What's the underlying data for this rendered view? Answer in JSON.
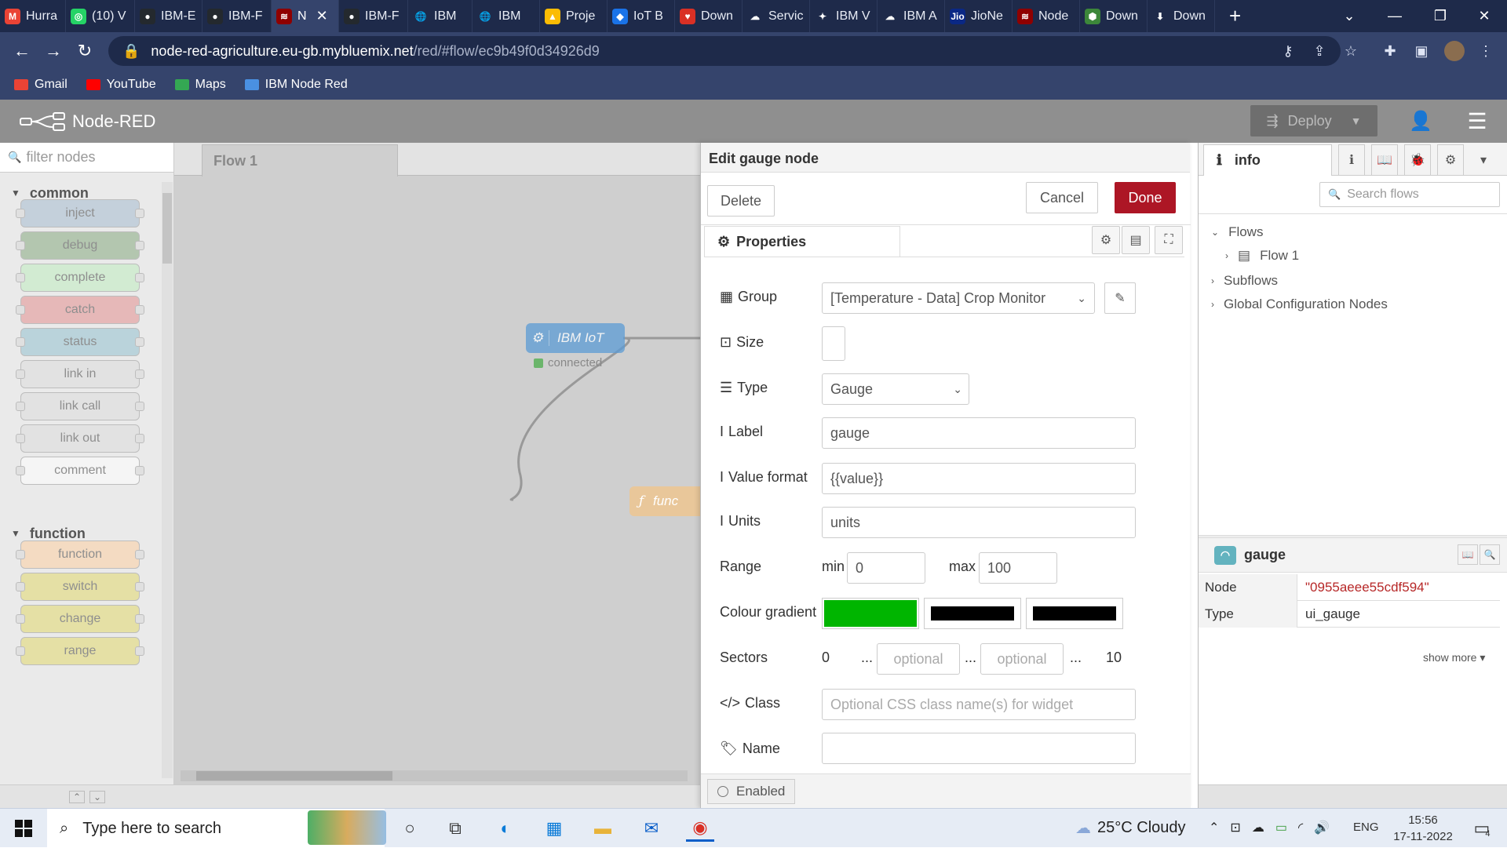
{
  "browser": {
    "tabs": [
      {
        "label": "Hurra",
        "icon": "gmail-icon",
        "color": "#ea4335",
        "glyph": "M"
      },
      {
        "label": "(10) V",
        "icon": "whatsapp-icon",
        "color": "#25d366",
        "glyph": "◎"
      },
      {
        "label": "IBM-E",
        "icon": "github-icon",
        "color": "#24292e",
        "glyph": "●"
      },
      {
        "label": "IBM-F",
        "icon": "github-icon",
        "color": "#24292e",
        "glyph": "●"
      },
      {
        "label": "N",
        "icon": "node-red-icon",
        "color": "#8f0000",
        "glyph": "≋",
        "active": true
      },
      {
        "label": "IBM-F",
        "icon": "github-icon",
        "color": "#24292e",
        "glyph": "●"
      },
      {
        "label": "IBM",
        "icon": "globe-icon",
        "color": "#1e2a4a",
        "glyph": "🌐"
      },
      {
        "label": "IBM",
        "icon": "globe-icon",
        "color": "#1e2a4a",
        "glyph": "🌐"
      },
      {
        "label": "Proje",
        "icon": "google-drive-icon",
        "color": "#fbbc04",
        "glyph": "▲"
      },
      {
        "label": "IoT B",
        "icon": "iot-icon",
        "color": "#1a73e8",
        "glyph": "◆"
      },
      {
        "label": "Down",
        "icon": "heart-icon",
        "color": "#d93025",
        "glyph": "♥"
      },
      {
        "label": "Servic",
        "icon": "cloud-icon",
        "color": "#1e2a4a",
        "glyph": "☁"
      },
      {
        "label": "IBM V",
        "icon": "ibm-icon",
        "color": "#1e2a4a",
        "glyph": "✦"
      },
      {
        "label": "IBM A",
        "icon": "cloud-icon",
        "color": "#1e2a4a",
        "glyph": "☁"
      },
      {
        "label": "JioNe",
        "icon": "jio-icon",
        "color": "#0a2885",
        "glyph": "Jio"
      },
      {
        "label": "Node",
        "icon": "node-red-icon",
        "color": "#8f0000",
        "glyph": "≋"
      },
      {
        "label": "Down",
        "icon": "nodejs-icon",
        "color": "#3c873a",
        "glyph": "⬢"
      },
      {
        "label": "Down",
        "icon": "download-icon",
        "color": "#1e2a4a",
        "glyph": "⬇"
      }
    ],
    "url_host": "node-red-agriculture.eu-gb.mybluemix.net",
    "url_path": "/red/#flow/ec9b49f0d34926d9",
    "bookmarks": [
      {
        "label": "Gmail",
        "color": "#ea4335"
      },
      {
        "label": "YouTube",
        "color": "#ff0000"
      },
      {
        "label": "Maps",
        "color": "#34a853"
      },
      {
        "label": "IBM Node Red",
        "color": "#4a90e2"
      }
    ]
  },
  "nodered": {
    "app_title": "Node-RED",
    "deploy_label": "Deploy",
    "palette": {
      "filter_placeholder": "filter nodes",
      "category_common": "common",
      "category_function": "function",
      "nodes": [
        {
          "label": "inject",
          "color": "#a6bbcf"
        },
        {
          "label": "debug",
          "color": "#87a980"
        },
        {
          "label": "complete",
          "color": "#c0edc0"
        },
        {
          "label": "catch",
          "color": "#e49191"
        },
        {
          "label": "status",
          "color": "#94c1d0"
        },
        {
          "label": "link in",
          "color": "#dddddd"
        },
        {
          "label": "link call",
          "color": "#dddddd"
        },
        {
          "label": "link out",
          "color": "#dddddd"
        },
        {
          "label": "comment",
          "color": "#ffffff"
        },
        {
          "label": "function",
          "color": "#fdd0a2"
        },
        {
          "label": "switch",
          "color": "#e2d96e"
        },
        {
          "label": "change",
          "color": "#e2d96e"
        },
        {
          "label": "range",
          "color": "#e2d96e"
        }
      ]
    },
    "workspace": {
      "flow_tab": "Flow 1",
      "ibm_iot_label": "IBM IoT",
      "ibm_iot_status": "connected",
      "function_label": "func"
    },
    "editor": {
      "title": "Edit gauge node",
      "delete_label": "Delete",
      "cancel_label": "Cancel",
      "done_label": "Done",
      "properties_tab": "Properties",
      "group_label": "Group",
      "group_value": "[Temperature - Data] Crop Monitor",
      "size_label": "Size",
      "type_label": "Type",
      "type_value": "Gauge",
      "label_label": "Label",
      "label_value": "gauge",
      "value_format_label": "Value format",
      "value_format_value": "{{value}}",
      "units_label": "Units",
      "units_value": "units",
      "range_label": "Range",
      "range_min_label": "min",
      "range_min_value": "0",
      "range_max_label": "max",
      "range_max_value": "100",
      "colour_gradient_label": "Colour gradient",
      "gradient_colors": [
        "#00b500",
        "#000000",
        "#000000"
      ],
      "sectors_label": "Sectors",
      "sectors_start": "0",
      "sectors_end": "10",
      "sectors_sep": "...",
      "sectors_placeholder": "optional",
      "class_label": "Class",
      "class_placeholder": "Optional CSS class name(s) for widget",
      "name_label": "Name",
      "name_value": "",
      "enabled_label": "Enabled"
    },
    "sidebar": {
      "info_tab": "info",
      "search_placeholder": "Search flows",
      "tree": {
        "flows": "Flows",
        "flow1": "Flow 1",
        "subflows": "Subflows",
        "global": "Global Configuration Nodes"
      },
      "node_title": "gauge",
      "props": [
        {
          "key": "Node",
          "value": "\"0955aeee55cdf594\""
        },
        {
          "key": "Type",
          "value": "ui_gauge"
        }
      ],
      "show_more": "show more"
    }
  },
  "taskbar": {
    "search_placeholder": "Type here to search",
    "weather": "25°C  Cloudy",
    "language": "ENG",
    "time": "15:56",
    "date": "17-11-2022",
    "notifications": "4"
  }
}
